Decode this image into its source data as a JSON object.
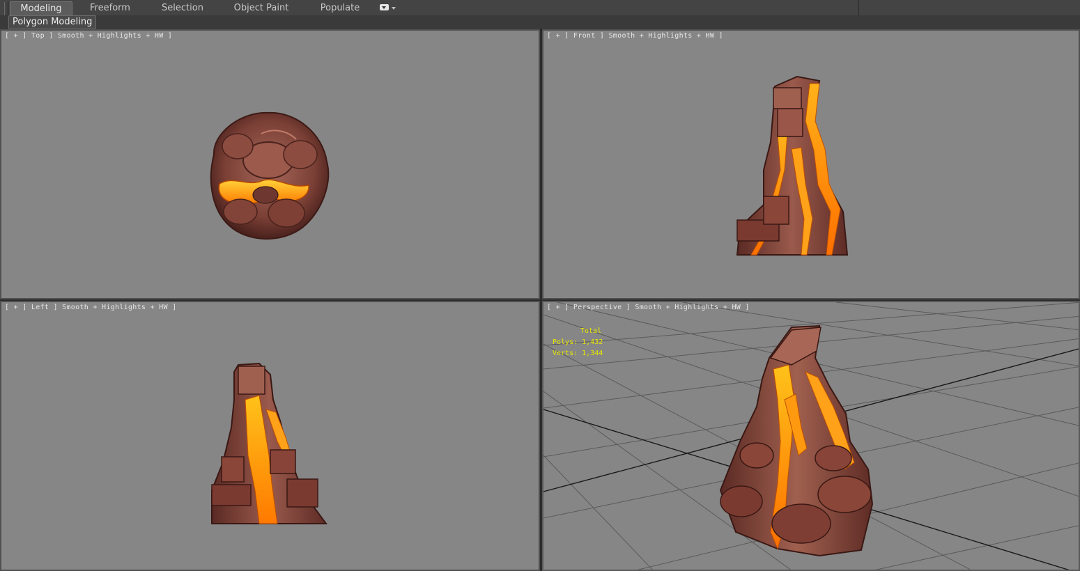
{
  "ribbon": {
    "tabs": [
      {
        "label": "Modeling",
        "active": true
      },
      {
        "label": "Freeform",
        "active": false
      },
      {
        "label": "Selection",
        "active": false
      },
      {
        "label": "Object Paint",
        "active": false
      },
      {
        "label": "Populate",
        "active": false
      }
    ],
    "panel_label": "Polygon Modeling"
  },
  "viewports": {
    "top": {
      "label": "[ + ] Top ] Smooth + Highlights + HW ]"
    },
    "front": {
      "label": "[ + ] Front ] Smooth + Highlights + HW ]"
    },
    "left": {
      "label": "[ + ] Left ] Smooth + Highlights + HW ]"
    },
    "perspective": {
      "label": "[ + ] Perspective ] Smooth + Highlights + HW ]"
    }
  },
  "stats": {
    "title": "Total",
    "polys": "Polys: 1,432",
    "verts": "Verts: 1,344"
  },
  "colors": {
    "viewport_bg": "#868686",
    "rock": "#8a4a3e",
    "rock_dark": "#5a2a24",
    "lava": "#ff8a10",
    "lava_bright": "#ffd23a",
    "stats_text": "#e8e800"
  }
}
